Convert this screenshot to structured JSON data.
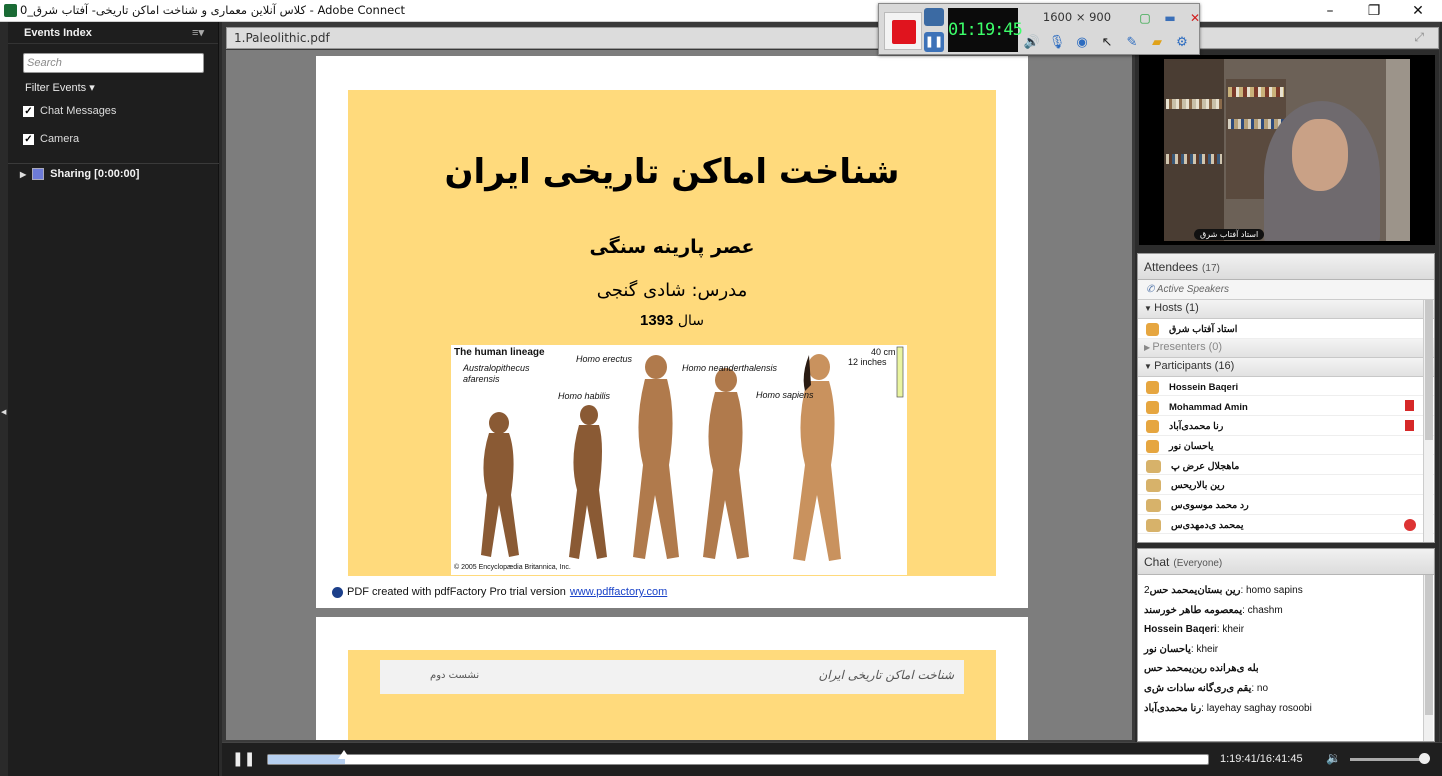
{
  "window": {
    "title": "کلاس آنلاین معماری و شناخت اماکن تاریخی- آفتاب شرق_0 - Adobe Connect",
    "minimize": "–",
    "maximize": "❐",
    "close": "✕"
  },
  "recorder": {
    "timer": "01:19:45",
    "resolution": "1600 × 900"
  },
  "events_index": {
    "title": "Events Index",
    "search_placeholder": "Search",
    "filter_label": "Filter Events",
    "checkboxes": [
      {
        "label": "Chat Messages",
        "checked": true
      },
      {
        "label": "Camera",
        "checked": true
      }
    ],
    "sharing_label": "Sharing [0:00:00]"
  },
  "document": {
    "tab_title": "1.Paleolithic.pdf",
    "slide1": {
      "title": "شناخت اماکن تاریخی ایران",
      "subtitle": "عصر پارینه سنگی",
      "teacher": "مدرس: شادی گنجی",
      "year_label": "سال",
      "year": "1393",
      "lineage": {
        "heading": "The human lineage",
        "species": [
          "Australopithecus afarensis",
          "Homo habilis",
          "Homo erectus",
          "Homo neanderthalensis",
          "Homo sapiens"
        ],
        "scale_cm": "40 cm",
        "scale_in": "12 inches",
        "copyright": "© 2005 Encyclopædia Britannica, Inc."
      },
      "pdf_note": "PDF created with pdfFactory Pro trial version",
      "pdf_link": "www.pdffactory.com"
    },
    "slide2": {
      "header_right": "شناخت اماکن تاریخی ایران",
      "header_left": "نشست دوم"
    }
  },
  "video": {
    "presenter_label": "استاد آفتاب شرق"
  },
  "attendees": {
    "title": "Attendees",
    "count": "(17)",
    "active_speakers": "Active Speakers",
    "hosts_label": "Hosts (1)",
    "hosts": [
      "استاد آفتاب شرق"
    ],
    "presenters_label": "Presenters (0)",
    "participants_label": "Participants (16)",
    "participants": [
      {
        "name": "Hossein Baqeri",
        "type": "user",
        "badge": ""
      },
      {
        "name": "Mohammad Amin",
        "type": "user",
        "badge": "raise-hand"
      },
      {
        "name": "رنا محمدی‌آباد",
        "type": "user",
        "badge": "raise-hand"
      },
      {
        "name": "یاحسان نور",
        "type": "user",
        "badge": ""
      },
      {
        "name": "ماهجلال عرض پ",
        "type": "group",
        "badge": ""
      },
      {
        "name": "رین بالاریحس",
        "type": "group",
        "badge": ""
      },
      {
        "name": "رد محمد موسوی‌س",
        "type": "group",
        "badge": ""
      },
      {
        "name": "یمحمد ی‌دمهدی‌س",
        "type": "group",
        "badge": "blocked"
      }
    ]
  },
  "chat": {
    "title": "Chat",
    "scope": "(Everyone)",
    "messages": [
      {
        "sender": "رین بستان‌یمحمد حس",
        "text": "2: homo sapins"
      },
      {
        "sender": "یمعصومه طاهر خورسند",
        "text": ": chashm"
      },
      {
        "sender": "Hossein Baqeri",
        "text": ": kheir"
      },
      {
        "sender": "یاحسان نور",
        "text": ": kheir"
      },
      {
        "sender": "بله ی‌هرانده رین‌یمحمد حس",
        "text": ""
      },
      {
        "sender": "یقم ی‌ری‌گانه سادات ش‌ی",
        "text": ": no"
      },
      {
        "sender": "رنا محمدی‌آباد",
        "text": ": layehay saghay rosoobi"
      }
    ]
  },
  "playback": {
    "position_fraction": 0.082,
    "timecode": "1:19:41/16:41:45",
    "volume_fraction": 0.95
  },
  "colors": {
    "slide_bg": "#ffda7c",
    "stop_red": "#e0141e",
    "timer_green": "#3cff6a"
  }
}
